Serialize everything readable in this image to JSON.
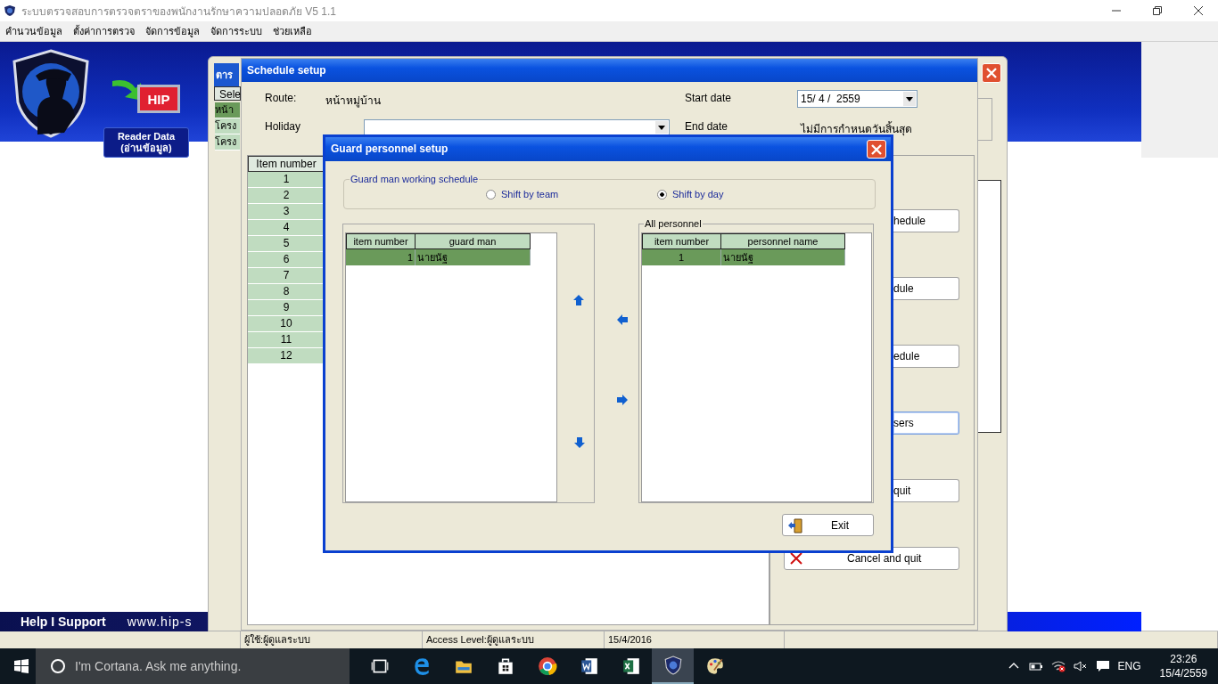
{
  "app_window": {
    "title": "ระบบตรวจสอบการตรวจตราของพนักงานรักษาความปลอดภัย V5 1.1",
    "menu": [
      "คำนวนข้อมูล",
      "ตั้งค่าการตรวจ",
      "จัดการข้อมูล",
      "จัดการระบบ",
      "ช่วยเหลือ"
    ]
  },
  "banner": {
    "logo_text": "HIP",
    "reader_button": [
      "Reader Data",
      "(อ่านข้อมูล)"
    ],
    "footer_label": "Help I Support",
    "footer_url": "www.hip-s"
  },
  "background_window": {
    "title": "ตาร",
    "table_header": "Sele",
    "rows": [
      {
        "text": "หน้า",
        "selected": true
      },
      {
        "text": "โครง",
        "selected": false
      },
      {
        "text": "โครง",
        "selected": false
      }
    ]
  },
  "schedule_setup": {
    "title": "Schedule setup",
    "route_label": "Route:",
    "route_value": "หน้าหมู่บ้าน",
    "holiday_label": "Holiday",
    "start_date_label": "Start date",
    "start_date": "15/ 4 /  2559",
    "end_date_label": "End date",
    "end_date_value": "ไม่มีการกำหนดวันสิ้นสุด",
    "item_table": {
      "column": "Item number",
      "rows": [
        "1",
        "2",
        "3",
        "4",
        "5",
        "6",
        "7",
        "8",
        "9",
        "10",
        "11",
        "12"
      ]
    },
    "buttons": [
      {
        "label": "hedule",
        "kind": "partial"
      },
      {
        "label": "dule",
        "kind": "partial"
      },
      {
        "label": "edule",
        "kind": "partial"
      },
      {
        "label": "sers",
        "kind": "partial"
      },
      {
        "label": "quit",
        "kind": "partial"
      },
      {
        "label": "Cancel and quit",
        "kind": "cancel"
      }
    ]
  },
  "guard_setup": {
    "title": "Guard personnel setup",
    "schedule_group": {
      "legend": "Guard man working schedule",
      "options": [
        {
          "label": "Shift by team",
          "selected": false
        },
        {
          "label": "Shift by day",
          "selected": true
        }
      ]
    },
    "guard_table": {
      "columns": [
        "item number",
        "guard man"
      ],
      "rows": [
        {
          "cells": [
            "1",
            "นายนัฐ"
          ],
          "selected": true
        }
      ]
    },
    "personnel_group": {
      "legend": "All personnel",
      "columns": [
        "item number",
        "personnel name"
      ],
      "rows": [
        {
          "cells": [
            "1",
            "นายนัฐ"
          ],
          "selected": true
        }
      ]
    },
    "exit_button": "Exit"
  },
  "status_bar": [
    "ผู้ใช้:ผู้ดูแลระบบ",
    "Access Level:ผู้ดูแลระบบ",
    "15/4/2016"
  ],
  "taskbar": {
    "search_placeholder": "I'm Cortana. Ask me anything.",
    "language": "ENG",
    "time": "23:26",
    "date": "15/4/2559"
  }
}
